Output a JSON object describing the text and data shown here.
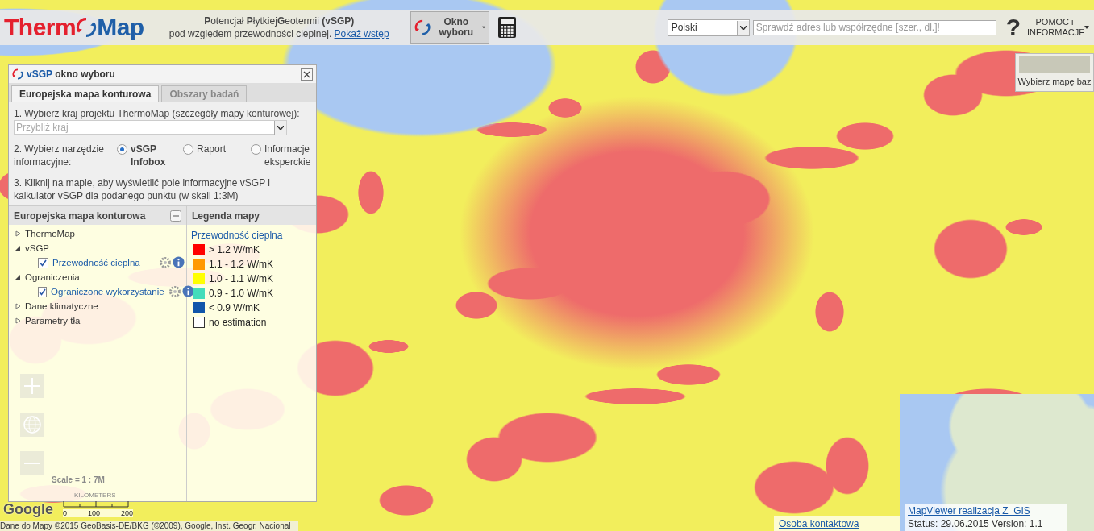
{
  "header": {
    "logo": {
      "before": "Therm",
      "after": "Map"
    },
    "title": "**P**otencjał **P**łytkiej**G**eotermii **(vSGP)**",
    "subtitle": "pod względem przewodności cieplnej.",
    "intro_link": "Pokaż wstęp",
    "selection_button": "Okno wyboru",
    "language": "Polski",
    "search": {
      "placeholder": "Sprawdź adres lub współrzędne [szer., dł.]!"
    },
    "help_icon": "?",
    "help_menu": "POMOC i INFORMACJE"
  },
  "basemap_picker": {
    "label": "Wybierz mapę baz"
  },
  "panel": {
    "title_prefix": "vSGP",
    "title": "okno wyboru",
    "tabs": [
      {
        "label": "Europejska mapa konturowa",
        "selected": true
      },
      {
        "label": "Obszary badań",
        "selected": false
      }
    ],
    "step1": "1. Wybierz kraj projektu ThermoMap (szczegóły mapy konturowej):",
    "country": {
      "placeholder": "Przybliż kraj"
    },
    "step2": "2. Wybierz narzędzie informacyjne:",
    "tools": [
      {
        "label": "vSGP Infobox",
        "selected": true
      },
      {
        "label": "Raport",
        "selected": false
      },
      {
        "label": "Informacje eksperckie",
        "selected": false
      }
    ],
    "step3": "3. Kliknij na mapie, aby wyświetlić pole informacyjne vSGP i kalkulator vSGP dla podanego punktu (w skali 1:3M)",
    "layers": {
      "title": "Europejska mapa konturowa",
      "tree": [
        {
          "label": "ThermoMap",
          "expanded": false
        },
        {
          "label": "vSGP",
          "expanded": true,
          "children": [
            {
              "label": "Przewodność cieplna",
              "checked": true
            }
          ]
        },
        {
          "label": "Ograniczenia",
          "expanded": true,
          "children": [
            {
              "label": "Ograniczone wykorzystanie",
              "checked": true
            }
          ]
        },
        {
          "label": "Dane klimatyczne",
          "expanded": false
        },
        {
          "label": "Parametry tła",
          "expanded": false
        }
      ]
    },
    "legend": {
      "title": "Legenda mapy",
      "layer": "Przewodność cieplna",
      "items": [
        {
          "label": "> 1.2 W/mK",
          "color": "#ff0000"
        },
        {
          "label": "1.1 -  1.2 W/mK",
          "color": "#ff9900"
        },
        {
          "label": "1.0 -  1.1 W/mK",
          "color": "#ffff00"
        },
        {
          "label": "0.9 -  1.0 W/mK",
          "color": "#44ddbb"
        },
        {
          "label": "< 0.9 W/mK",
          "color": "#1155aa"
        },
        {
          "label": "no estimation",
          "color": "#ffffff"
        }
      ]
    }
  },
  "map": {
    "scale": "Scale = 1 : 7M",
    "scale_unit": "KILOMETERS",
    "scale_ticks": [
      "0",
      "100",
      "200"
    ],
    "logo": "Google",
    "attribution": "Dane do Mapy ©2015 GeoBasis-DE/BKG (©2009), Google, Inst. Geogr. Nacional"
  },
  "footer": {
    "contact_link": "Osoba kontaktowa",
    "credit_link": "MapViewer realizacja Z_GIS",
    "status": "Status: 29.06.2015 Version: 1.1"
  }
}
